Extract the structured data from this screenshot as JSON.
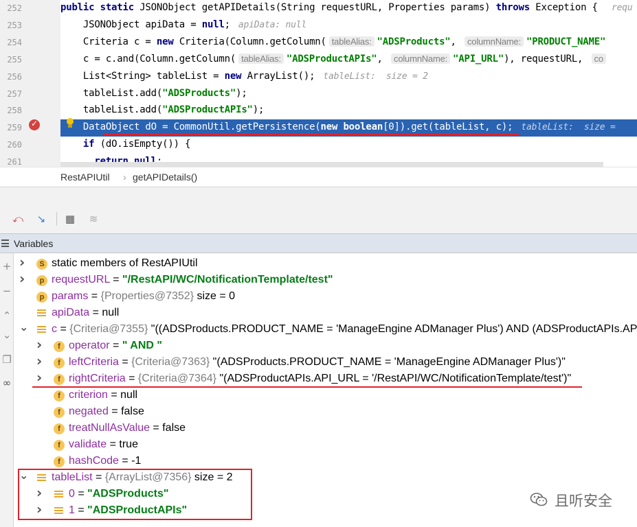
{
  "editor": {
    "lines": [
      {
        "num": "252",
        "parts": [
          [
            "kw",
            "public static "
          ],
          [
            "t",
            "JSONObject getAPIDetails(String requestURL, Properties params) "
          ],
          [
            "kw",
            "throws "
          ],
          [
            "t",
            "Exception { "
          ],
          [
            "inl",
            "requ"
          ]
        ]
      },
      {
        "num": "253",
        "parts": [
          [
            "t",
            "    JSONObject apiData = "
          ],
          [
            "kw",
            "null"
          ],
          [
            "t",
            ";"
          ],
          [
            "inl",
            "apiData: null"
          ]
        ]
      },
      {
        "num": "254",
        "parts": [
          [
            "t",
            "    Criteria c = "
          ],
          [
            "kw",
            "new "
          ],
          [
            "t",
            "Criteria(Column.getColumn("
          ],
          [
            "hint",
            "tableAlias:"
          ],
          [
            "st",
            "\"ADSProducts\""
          ],
          [
            "t",
            ", "
          ],
          [
            "hint",
            "columnName:"
          ],
          [
            "st",
            "\"PRODUCT_NAME\""
          ]
        ]
      },
      {
        "num": "255",
        "parts": [
          [
            "t",
            "    c = c.and(Column.getColumn("
          ],
          [
            "hint",
            "tableAlias:"
          ],
          [
            "st",
            "\"ADSProductAPIs\""
          ],
          [
            "t",
            ", "
          ],
          [
            "hint",
            "columnName:"
          ],
          [
            "st",
            "\"API_URL\""
          ],
          [
            "t",
            "), requestURL, "
          ],
          [
            "hint",
            "co"
          ]
        ]
      },
      {
        "num": "256",
        "parts": [
          [
            "t",
            "    List<String> tableList = "
          ],
          [
            "kw",
            "new "
          ],
          [
            "t",
            "ArrayList();"
          ],
          [
            "inl",
            "tableList:  size = 2"
          ]
        ]
      },
      {
        "num": "257",
        "parts": [
          [
            "t",
            "    tableList.add("
          ],
          [
            "st",
            "\"ADSProducts\""
          ],
          [
            "t",
            ");"
          ]
        ]
      },
      {
        "num": "258",
        "parts": [
          [
            "t",
            "    tableList.add("
          ],
          [
            "st",
            "\"ADSProductAPIs\""
          ],
          [
            "t",
            ");"
          ]
        ]
      },
      {
        "num": "259",
        "parts": [
          [
            "t",
            "    DataObject dO = CommonUtil.getPersistence("
          ],
          [
            "kw",
            "new boolean"
          ],
          [
            "t",
            "[0]).get(tableList, c);"
          ],
          [
            "inl",
            "tableList:  size = "
          ]
        ]
      },
      {
        "num": "260",
        "parts": [
          [
            "t",
            "    "
          ],
          [
            "kw",
            "if "
          ],
          [
            "t",
            "(dO.isEmpty()) {"
          ]
        ]
      },
      {
        "num": "261",
        "parts": [
          [
            "t",
            "      "
          ],
          [
            "kw",
            "return null"
          ],
          [
            "t",
            ";"
          ]
        ]
      }
    ]
  },
  "breadcrumb": {
    "class_name": "RestAPIUtil",
    "separator": "›",
    "method": "getAPIDetails()"
  },
  "debug_toolbar": {
    "icons": [
      "drop-frame-icon",
      "run-to-cursor-icon",
      "evaluate-expression-icon",
      "trace-current-stream-icon"
    ]
  },
  "variables_panel": {
    "title": "Variables",
    "rows": [
      {
        "level": 0,
        "arrow": "right",
        "icon": "S",
        "parts": [
          [
            "stat",
            "static "
          ],
          [
            "g",
            "members of RestAPIUtil"
          ]
        ]
      },
      {
        "level": 0,
        "arrow": "right",
        "icon": "p",
        "parts": [
          [
            "nm",
            "requestURL"
          ],
          [
            "eq",
            " = "
          ],
          [
            "sv",
            "\"/RestAPI/WC/NotificationTemplate/test\""
          ]
        ]
      },
      {
        "level": 0,
        "arrow": "",
        "icon": "p",
        "parts": [
          [
            "nm",
            "params"
          ],
          [
            "eq",
            " = "
          ],
          [
            "oid",
            "{Properties@7352}"
          ],
          [
            "val",
            "  size = 0"
          ]
        ]
      },
      {
        "level": 0,
        "arrow": "",
        "icon": "lines",
        "parts": [
          [
            "nm",
            "apiData"
          ],
          [
            "eq",
            " = "
          ],
          [
            "val",
            "null"
          ]
        ]
      },
      {
        "level": 0,
        "arrow": "down",
        "icon": "lines",
        "parts": [
          [
            "nm",
            "c"
          ],
          [
            "eq",
            " = "
          ],
          [
            "oid",
            "{Criteria@7355}"
          ],
          [
            "val",
            " \"((ADSProducts.PRODUCT_NAME = 'ManageEngine ADManager Plus') AND (ADSProductAPIs.API_U"
          ]
        ]
      },
      {
        "level": 1,
        "arrow": "right",
        "icon": "f",
        "parts": [
          [
            "nm",
            "operator"
          ],
          [
            "eq",
            " = "
          ],
          [
            "sv",
            "\" AND \""
          ]
        ]
      },
      {
        "level": 1,
        "arrow": "right",
        "icon": "f",
        "parts": [
          [
            "nm",
            "leftCriteria"
          ],
          [
            "eq",
            " = "
          ],
          [
            "oid",
            "{Criteria@7363}"
          ],
          [
            "val",
            " \"(ADSProducts.PRODUCT_NAME = 'ManageEngine ADManager Plus')\""
          ]
        ]
      },
      {
        "level": 1,
        "arrow": "right",
        "icon": "f",
        "parts": [
          [
            "nm",
            "rightCriteria"
          ],
          [
            "eq",
            " = "
          ],
          [
            "oid",
            "{Criteria@7364}"
          ],
          [
            "val",
            " \"(ADSProductAPIs.API_URL = '/RestAPI/WC/NotificationTemplate/test')\""
          ]
        ]
      },
      {
        "level": 1,
        "arrow": "",
        "icon": "f",
        "parts": [
          [
            "nm",
            "criterion"
          ],
          [
            "eq",
            " = "
          ],
          [
            "val",
            "null"
          ]
        ]
      },
      {
        "level": 1,
        "arrow": "",
        "icon": "f",
        "parts": [
          [
            "nm",
            "negated"
          ],
          [
            "eq",
            " = "
          ],
          [
            "val",
            "false"
          ]
        ]
      },
      {
        "level": 1,
        "arrow": "",
        "icon": "f",
        "parts": [
          [
            "nm",
            "treatNullAsValue"
          ],
          [
            "eq",
            " = "
          ],
          [
            "val",
            "false"
          ]
        ]
      },
      {
        "level": 1,
        "arrow": "",
        "icon": "f",
        "parts": [
          [
            "nm",
            "validate"
          ],
          [
            "eq",
            " = "
          ],
          [
            "val",
            "true"
          ]
        ]
      },
      {
        "level": 1,
        "arrow": "",
        "icon": "f",
        "parts": [
          [
            "nm",
            "hashCode"
          ],
          [
            "eq",
            " = "
          ],
          [
            "val",
            "-1"
          ]
        ]
      },
      {
        "level": 0,
        "arrow": "down",
        "icon": "lines",
        "parts": [
          [
            "nm",
            "tableList"
          ],
          [
            "eq",
            " = "
          ],
          [
            "oid",
            "{ArrayList@7356}"
          ],
          [
            "val",
            "  size = 2"
          ]
        ]
      },
      {
        "level": 1,
        "arrow": "right",
        "icon": "lines",
        "parts": [
          [
            "nm",
            "0"
          ],
          [
            "eq",
            " = "
          ],
          [
            "sv",
            "\"ADSProducts\""
          ]
        ]
      },
      {
        "level": 1,
        "arrow": "right",
        "icon": "lines",
        "parts": [
          [
            "nm",
            "1"
          ],
          [
            "eq",
            " = "
          ],
          [
            "sv",
            "\"ADSProductAPIs\""
          ]
        ]
      }
    ]
  },
  "watermark": {
    "text": "且听安全",
    "icon": "wechat-icon"
  },
  "colors": {
    "highlight_line": "#2a63b2",
    "annotation_red": "#e0212d",
    "string_green": "#067d17",
    "field_purple": "#8d2ea0"
  }
}
